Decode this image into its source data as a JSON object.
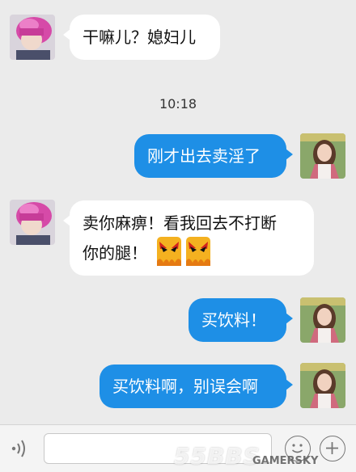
{
  "messages": [
    {
      "text": "干嘛儿？媳妇儿"
    },
    {
      "text": "刚才出去卖淫了"
    },
    {
      "line1": "卖你麻痹！看我回去不打断",
      "line2": "你的腿！"
    },
    {
      "text": "买饮料！"
    },
    {
      "text": "买饮料啊，别误会啊"
    }
  ],
  "timestamp": "10:18",
  "composer": {
    "input_value": "",
    "voice_icon": "voice-wave-icon",
    "emoji_icon": "smiley-icon",
    "plus_icon": "plus-icon"
  },
  "emoji": {
    "name": "angry-face-emoji",
    "count": 2
  },
  "watermark": {
    "main": "55BBS",
    "sub": "GAMERSKY"
  },
  "colors": {
    "outgoing_bubble": "#1e8fe6",
    "incoming_bubble": "#ffffff",
    "background": "#ebebeb"
  }
}
